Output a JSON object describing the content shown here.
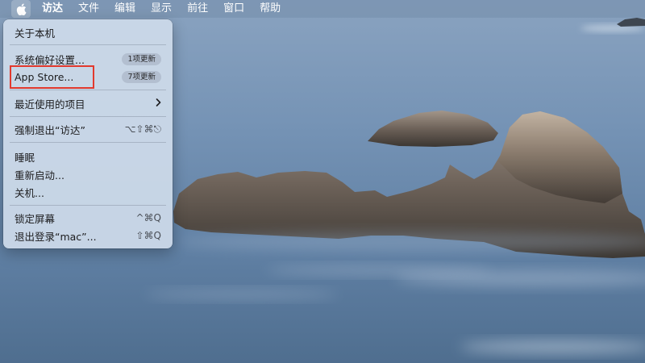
{
  "menubar": {
    "apple_icon": "apple-icon",
    "items": [
      "访达",
      "文件",
      "编辑",
      "显示",
      "前往",
      "窗口",
      "帮助"
    ]
  },
  "apple_menu": {
    "about": "关于本机",
    "system_prefs": {
      "label": "系统偏好设置...",
      "badge": "1项更新"
    },
    "app_store": {
      "label": "App Store...",
      "badge": "7项更新"
    },
    "recent_items": "最近使用的项目",
    "force_quit": {
      "label": "强制退出“访达”",
      "shortcut": "⌥⇧⌘⎋"
    },
    "sleep": "睡眠",
    "restart": "重新启动...",
    "shutdown": "关机...",
    "lock_screen": {
      "label": "锁定屏幕",
      "shortcut": "^⌘Q"
    },
    "logout": {
      "label": "退出登录“mac”...",
      "shortcut": "⇧⌘Q"
    }
  },
  "colors": {
    "highlight_border": "#e2392d",
    "menu_background": "#cddaea",
    "menubar_background": "#7891af"
  }
}
